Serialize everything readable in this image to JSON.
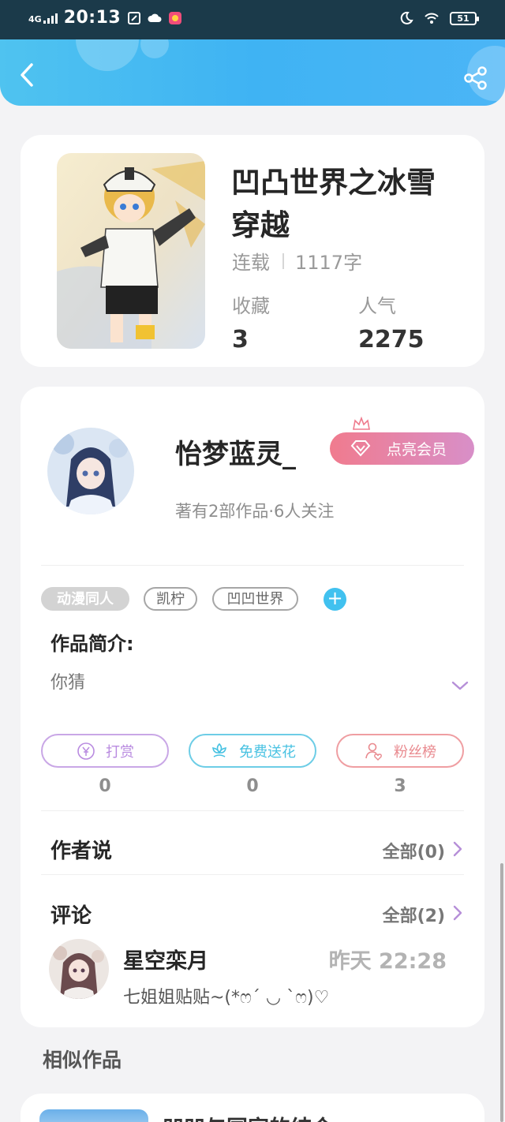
{
  "status_bar": {
    "network": "4G",
    "time": "20:13",
    "battery": "51"
  },
  "book": {
    "title": "凹凸世界之冰雪穿越",
    "status": "连载",
    "word_count": "1117字",
    "favorites_label": "收藏",
    "favorites_value": "3",
    "popularity_label": "人气",
    "popularity_value": "2275"
  },
  "author": {
    "name": "怡梦蓝灵_",
    "vip_button": "点亮会员",
    "meta": "著有2部作品·6人关注"
  },
  "tags": [
    "动漫同人",
    "凯柠",
    "凹凹世界"
  ],
  "tag_add": "+",
  "intro": {
    "label": "作品简介:",
    "text": "你猜"
  },
  "actions": [
    {
      "label": "打赏",
      "count": "0",
      "color": "#b98be0"
    },
    {
      "label": "免费送花",
      "count": "0",
      "color": "#48c2e2"
    },
    {
      "label": "粉丝榜",
      "count": "3",
      "color": "#e98a8f"
    }
  ],
  "author_says": {
    "title": "作者说",
    "link": "全部(0)"
  },
  "comments": {
    "title": "评论",
    "link": "全部(2)",
    "items": [
      {
        "user": "星空栾月",
        "time": "昨天 22:28",
        "text": "七姐姐贴贴~(*ෆ´ ◡ `ෆ)♡"
      }
    ]
  },
  "similar": {
    "title": "相似作品",
    "first_title": "凹凹与国家的结合"
  }
}
